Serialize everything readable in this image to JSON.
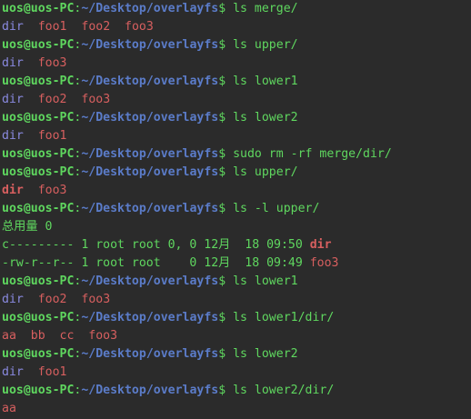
{
  "prompt": {
    "user": "uos@uos-PC",
    "colon": ":",
    "path": "~/Desktop/overlayfs",
    "dollar": "$"
  },
  "lines": [
    {
      "type": "prompt",
      "cmd": " ls merge/"
    },
    {
      "type": "out",
      "items": [
        {
          "text": "dir",
          "cls": "dir"
        },
        {
          "text": "  ",
          "cls": "plain"
        },
        {
          "text": "foo1",
          "cls": "file"
        },
        {
          "text": "  ",
          "cls": "plain"
        },
        {
          "text": "foo2",
          "cls": "file"
        },
        {
          "text": "  ",
          "cls": "plain"
        },
        {
          "text": "foo3",
          "cls": "file"
        }
      ]
    },
    {
      "type": "prompt",
      "cmd": " ls upper/"
    },
    {
      "type": "out",
      "items": [
        {
          "text": "dir",
          "cls": "dir"
        },
        {
          "text": "  ",
          "cls": "plain"
        },
        {
          "text": "foo3",
          "cls": "file"
        }
      ]
    },
    {
      "type": "prompt",
      "cmd": " ls lower1"
    },
    {
      "type": "out",
      "items": [
        {
          "text": "dir",
          "cls": "dir"
        },
        {
          "text": "  ",
          "cls": "plain"
        },
        {
          "text": "foo2",
          "cls": "file"
        },
        {
          "text": "  ",
          "cls": "plain"
        },
        {
          "text": "foo3",
          "cls": "file"
        }
      ]
    },
    {
      "type": "prompt",
      "cmd": " ls lower2"
    },
    {
      "type": "out",
      "items": [
        {
          "text": "dir",
          "cls": "dir"
        },
        {
          "text": "  ",
          "cls": "plain"
        },
        {
          "text": "foo1",
          "cls": "file"
        }
      ]
    },
    {
      "type": "prompt",
      "cmd": " sudo rm -rf merge/dir/"
    },
    {
      "type": "prompt",
      "cmd": " ls upper/"
    },
    {
      "type": "out",
      "items": [
        {
          "text": "dir",
          "cls": "dirbold"
        },
        {
          "text": "  ",
          "cls": "plain"
        },
        {
          "text": "foo3",
          "cls": "file"
        }
      ]
    },
    {
      "type": "prompt",
      "cmd": " ls -l upper/"
    },
    {
      "type": "out",
      "items": [
        {
          "text": "总用量 0",
          "cls": "green"
        }
      ]
    },
    {
      "type": "out",
      "items": [
        {
          "text": "c--------- 1 root root 0, 0 12月  18 09:50 ",
          "cls": "green"
        },
        {
          "text": "dir",
          "cls": "dirbold"
        }
      ]
    },
    {
      "type": "out",
      "items": [
        {
          "text": "-rw-r--r-- 1 root root    0 12月  18 09:49 ",
          "cls": "green"
        },
        {
          "text": "foo3",
          "cls": "file"
        }
      ]
    },
    {
      "type": "prompt",
      "cmd": " ls lower1"
    },
    {
      "type": "out",
      "items": [
        {
          "text": "dir",
          "cls": "dir"
        },
        {
          "text": "  ",
          "cls": "plain"
        },
        {
          "text": "foo2",
          "cls": "file"
        },
        {
          "text": "  ",
          "cls": "plain"
        },
        {
          "text": "foo3",
          "cls": "file"
        }
      ]
    },
    {
      "type": "prompt",
      "cmd": " ls lower1/dir/"
    },
    {
      "type": "out",
      "items": [
        {
          "text": "aa  bb  cc  foo3",
          "cls": "file"
        }
      ]
    },
    {
      "type": "prompt",
      "cmd": " ls lower2"
    },
    {
      "type": "out",
      "items": [
        {
          "text": "dir",
          "cls": "dir"
        },
        {
          "text": "  ",
          "cls": "plain"
        },
        {
          "text": "foo1",
          "cls": "file"
        }
      ]
    },
    {
      "type": "prompt",
      "cmd": " ls lower2/dir/"
    },
    {
      "type": "out",
      "items": [
        {
          "text": "aa",
          "cls": "file"
        }
      ]
    }
  ],
  "colors": {
    "background": "#2b2b2b",
    "prompt_user": "#5fd75f",
    "prompt_path": "#5b7cc9",
    "directory": "#8a8ae0",
    "file": "#d75f5f",
    "text": "#5fd75f"
  }
}
